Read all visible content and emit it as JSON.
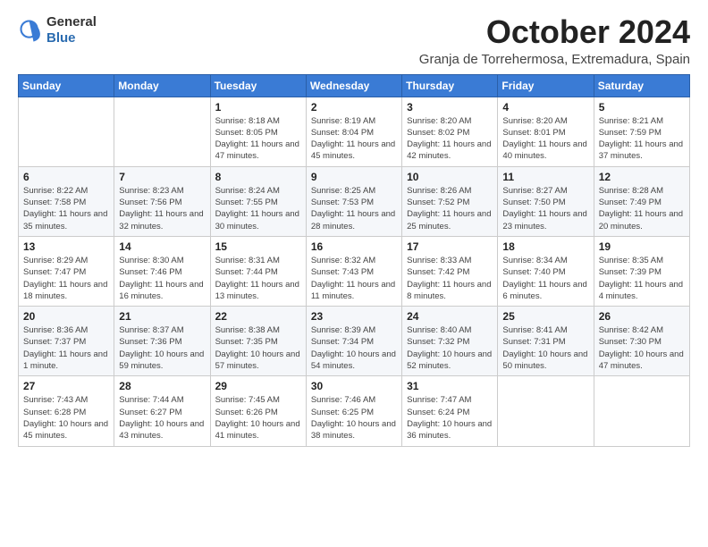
{
  "logo": {
    "general": "General",
    "blue": "Blue"
  },
  "header": {
    "month_title": "October 2024",
    "location": "Granja de Torrehermosa, Extremadura, Spain"
  },
  "weekdays": [
    "Sunday",
    "Monday",
    "Tuesday",
    "Wednesday",
    "Thursday",
    "Friday",
    "Saturday"
  ],
  "weeks": [
    [
      {
        "day": "",
        "info": ""
      },
      {
        "day": "",
        "info": ""
      },
      {
        "day": "1",
        "info": "Sunrise: 8:18 AM\nSunset: 8:05 PM\nDaylight: 11 hours and 47 minutes."
      },
      {
        "day": "2",
        "info": "Sunrise: 8:19 AM\nSunset: 8:04 PM\nDaylight: 11 hours and 45 minutes."
      },
      {
        "day": "3",
        "info": "Sunrise: 8:20 AM\nSunset: 8:02 PM\nDaylight: 11 hours and 42 minutes."
      },
      {
        "day": "4",
        "info": "Sunrise: 8:20 AM\nSunset: 8:01 PM\nDaylight: 11 hours and 40 minutes."
      },
      {
        "day": "5",
        "info": "Sunrise: 8:21 AM\nSunset: 7:59 PM\nDaylight: 11 hours and 37 minutes."
      }
    ],
    [
      {
        "day": "6",
        "info": "Sunrise: 8:22 AM\nSunset: 7:58 PM\nDaylight: 11 hours and 35 minutes."
      },
      {
        "day": "7",
        "info": "Sunrise: 8:23 AM\nSunset: 7:56 PM\nDaylight: 11 hours and 32 minutes."
      },
      {
        "day": "8",
        "info": "Sunrise: 8:24 AM\nSunset: 7:55 PM\nDaylight: 11 hours and 30 minutes."
      },
      {
        "day": "9",
        "info": "Sunrise: 8:25 AM\nSunset: 7:53 PM\nDaylight: 11 hours and 28 minutes."
      },
      {
        "day": "10",
        "info": "Sunrise: 8:26 AM\nSunset: 7:52 PM\nDaylight: 11 hours and 25 minutes."
      },
      {
        "day": "11",
        "info": "Sunrise: 8:27 AM\nSunset: 7:50 PM\nDaylight: 11 hours and 23 minutes."
      },
      {
        "day": "12",
        "info": "Sunrise: 8:28 AM\nSunset: 7:49 PM\nDaylight: 11 hours and 20 minutes."
      }
    ],
    [
      {
        "day": "13",
        "info": "Sunrise: 8:29 AM\nSunset: 7:47 PM\nDaylight: 11 hours and 18 minutes."
      },
      {
        "day": "14",
        "info": "Sunrise: 8:30 AM\nSunset: 7:46 PM\nDaylight: 11 hours and 16 minutes."
      },
      {
        "day": "15",
        "info": "Sunrise: 8:31 AM\nSunset: 7:44 PM\nDaylight: 11 hours and 13 minutes."
      },
      {
        "day": "16",
        "info": "Sunrise: 8:32 AM\nSunset: 7:43 PM\nDaylight: 11 hours and 11 minutes."
      },
      {
        "day": "17",
        "info": "Sunrise: 8:33 AM\nSunset: 7:42 PM\nDaylight: 11 hours and 8 minutes."
      },
      {
        "day": "18",
        "info": "Sunrise: 8:34 AM\nSunset: 7:40 PM\nDaylight: 11 hours and 6 minutes."
      },
      {
        "day": "19",
        "info": "Sunrise: 8:35 AM\nSunset: 7:39 PM\nDaylight: 11 hours and 4 minutes."
      }
    ],
    [
      {
        "day": "20",
        "info": "Sunrise: 8:36 AM\nSunset: 7:37 PM\nDaylight: 11 hours and 1 minute."
      },
      {
        "day": "21",
        "info": "Sunrise: 8:37 AM\nSunset: 7:36 PM\nDaylight: 10 hours and 59 minutes."
      },
      {
        "day": "22",
        "info": "Sunrise: 8:38 AM\nSunset: 7:35 PM\nDaylight: 10 hours and 57 minutes."
      },
      {
        "day": "23",
        "info": "Sunrise: 8:39 AM\nSunset: 7:34 PM\nDaylight: 10 hours and 54 minutes."
      },
      {
        "day": "24",
        "info": "Sunrise: 8:40 AM\nSunset: 7:32 PM\nDaylight: 10 hours and 52 minutes."
      },
      {
        "day": "25",
        "info": "Sunrise: 8:41 AM\nSunset: 7:31 PM\nDaylight: 10 hours and 50 minutes."
      },
      {
        "day": "26",
        "info": "Sunrise: 8:42 AM\nSunset: 7:30 PM\nDaylight: 10 hours and 47 minutes."
      }
    ],
    [
      {
        "day": "27",
        "info": "Sunrise: 7:43 AM\nSunset: 6:28 PM\nDaylight: 10 hours and 45 minutes."
      },
      {
        "day": "28",
        "info": "Sunrise: 7:44 AM\nSunset: 6:27 PM\nDaylight: 10 hours and 43 minutes."
      },
      {
        "day": "29",
        "info": "Sunrise: 7:45 AM\nSunset: 6:26 PM\nDaylight: 10 hours and 41 minutes."
      },
      {
        "day": "30",
        "info": "Sunrise: 7:46 AM\nSunset: 6:25 PM\nDaylight: 10 hours and 38 minutes."
      },
      {
        "day": "31",
        "info": "Sunrise: 7:47 AM\nSunset: 6:24 PM\nDaylight: 10 hours and 36 minutes."
      },
      {
        "day": "",
        "info": ""
      },
      {
        "day": "",
        "info": ""
      }
    ]
  ]
}
